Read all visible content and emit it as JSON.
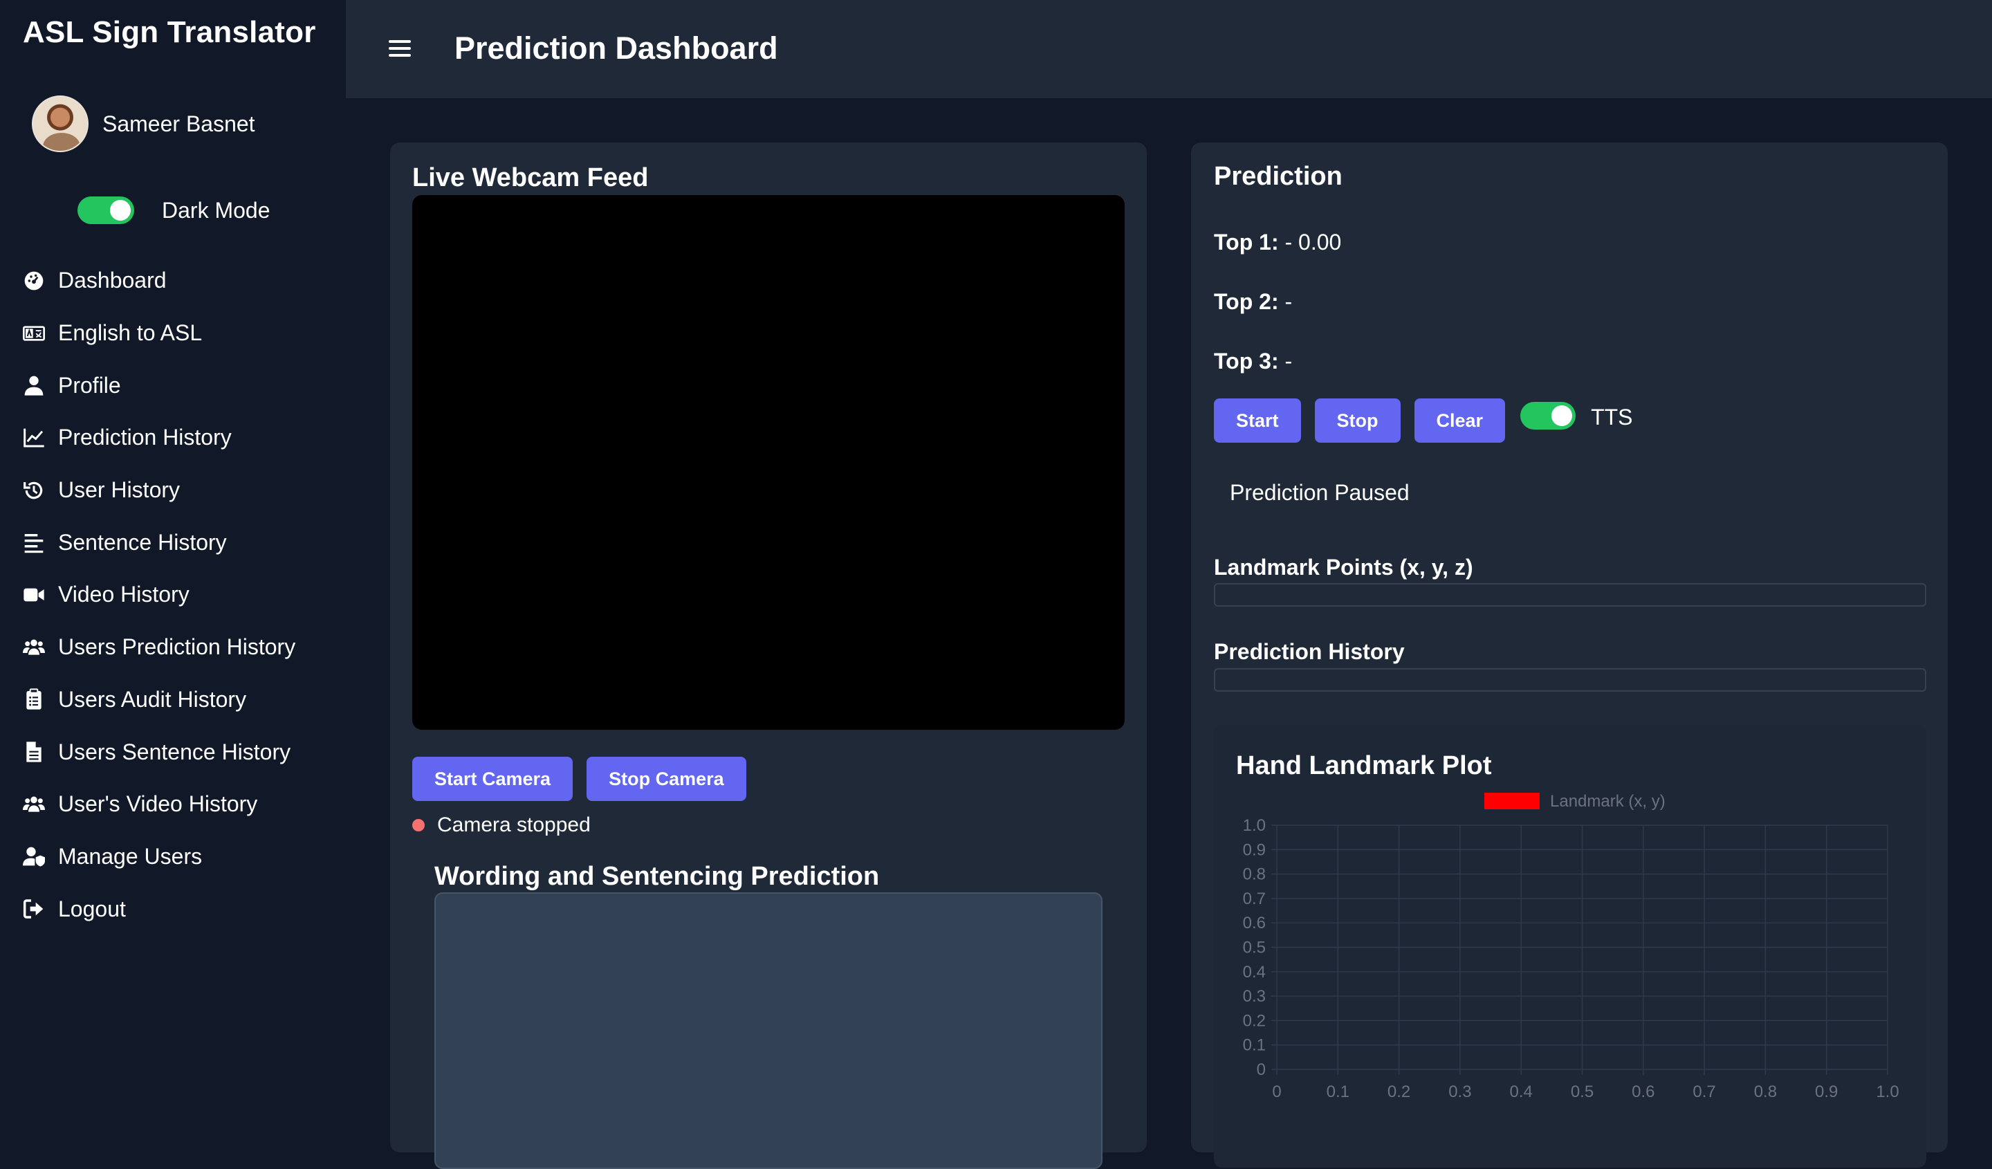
{
  "app": {
    "title": "ASL Sign Translator"
  },
  "user": {
    "name": "Sameer Basnet"
  },
  "dark_mode": {
    "label": "Dark Mode",
    "enabled": true
  },
  "nav": [
    {
      "label": "Dashboard",
      "icon": "dashboard-icon"
    },
    {
      "label": "English to ASL",
      "icon": "language-icon"
    },
    {
      "label": "Profile",
      "icon": "user-icon"
    },
    {
      "label": "Prediction History",
      "icon": "chart-line-icon"
    },
    {
      "label": "User History",
      "icon": "history-icon"
    },
    {
      "label": "Sentence History",
      "icon": "align-left-icon"
    },
    {
      "label": "Video History",
      "icon": "video-icon"
    },
    {
      "label": "Users Prediction History",
      "icon": "users-icon"
    },
    {
      "label": "Users Audit History",
      "icon": "clipboard-icon"
    },
    {
      "label": "Users Sentence History",
      "icon": "file-icon"
    },
    {
      "label": "User's Video History",
      "icon": "users-icon"
    },
    {
      "label": "Manage Users",
      "icon": "user-shield-icon"
    },
    {
      "label": "Logout",
      "icon": "logout-icon"
    }
  ],
  "header": {
    "title": "Prediction Dashboard"
  },
  "webcam": {
    "title": "Live Webcam Feed",
    "start_label": "Start Camera",
    "stop_label": "Stop Camera",
    "status": "Camera stopped"
  },
  "wording": {
    "title": "Wording and Sentencing Prediction"
  },
  "prediction": {
    "title": "Prediction",
    "top1_label": "Top 1:",
    "top1_value": "- 0.00",
    "top2_label": "Top 2:",
    "top2_value": "-",
    "top3_label": "Top 3:",
    "top3_value": "-",
    "start_label": "Start",
    "stop_label": "Stop",
    "clear_label": "Clear",
    "tts_label": "TTS",
    "tts_enabled": true,
    "status": "Prediction Paused",
    "landmark_title": "Landmark Points (x, y, z)",
    "history_title": "Prediction History"
  },
  "chart_data": {
    "type": "scatter",
    "title": "Hand Landmark Plot",
    "series": [
      {
        "name": "Landmark (x, y)",
        "color": "#ff0000",
        "points": []
      }
    ],
    "xlim": [
      0,
      1.0
    ],
    "ylim": [
      0,
      1.0
    ],
    "xticks": [
      "0",
      "0.1",
      "0.2",
      "0.3",
      "0.4",
      "0.5",
      "0.6",
      "0.7",
      "0.8",
      "0.9",
      "1.0"
    ],
    "yticks": [
      "0",
      "0.1",
      "0.2",
      "0.3",
      "0.4",
      "0.5",
      "0.6",
      "0.7",
      "0.8",
      "0.9",
      "1.0"
    ],
    "grid": true,
    "legend": "top-center"
  },
  "colors": {
    "accent": "#6366f1",
    "toggle_on": "#22c55e",
    "status_dot": "#f87171"
  }
}
